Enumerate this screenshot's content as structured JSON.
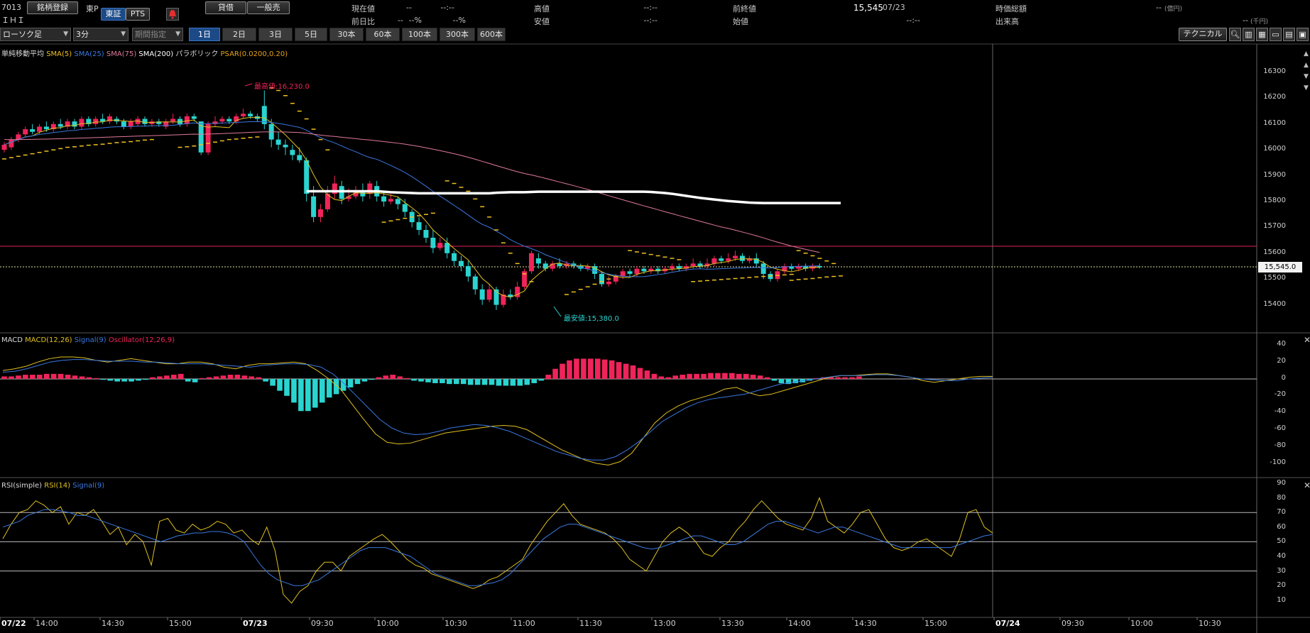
{
  "header": {
    "code": "7013",
    "name": "ＩＨＩ",
    "market_label": "東P",
    "register_button": "銘柄登録",
    "tse_button": "東証",
    "pts_button": "PTS",
    "loan_button": "貸借",
    "general_short_button": "一般売"
  },
  "quote": {
    "current_price_label": "現在値",
    "current_price_value": "--",
    "current_time": "--:--",
    "change_label": "前日比",
    "change_value": "--",
    "change_pct": "--%",
    "change_pct2": "--%",
    "high_label": "高値",
    "high_value": "--",
    "high_time": "--:--",
    "low_label": "安値",
    "low_value": "--",
    "low_time": "--:--",
    "prev_close_label": "前終値",
    "prev_close_value": "15,545",
    "prev_close_date": "07/23",
    "open_label": "始値",
    "open_value": "--",
    "open_time": "--:--",
    "market_cap_label": "時価総額",
    "market_cap_value": "--",
    "market_cap_unit": "(億円)",
    "volume_label": "出来高",
    "volume_value": "--",
    "volume_unit": "(千円)"
  },
  "toolbar": {
    "chart_type": "ローソク足",
    "interval": "3分",
    "range_select": "期間指定",
    "periods": [
      "1日",
      "2日",
      "3日",
      "5日",
      "30本",
      "60本",
      "100本",
      "300本",
      "600本"
    ],
    "active_period": 0,
    "technical_button": "テクニカル",
    "icons": [
      "zoom-icon",
      "bar-chart-icon",
      "table-icon",
      "folder-icon",
      "settings-icon"
    ]
  },
  "price_panel": {
    "legend": [
      "単純移動平均",
      "SMA(5)",
      "SMA(25)",
      "SMA(75)",
      "SMA(200)",
      "パラボリック",
      "PSAR(0.0200,0.20)"
    ],
    "legend_colors": [
      "#d8d8d8",
      "#f0c020",
      "#3a78e0",
      "#e0709a",
      "#ffffff",
      "#d8d8d8",
      "#e6a21a"
    ],
    "y_ticks": [
      "16300",
      "16200",
      "16100",
      "16000",
      "15900",
      "15800",
      "15700",
      "15600",
      "15500",
      "15400"
    ],
    "high_annotation": "最高値:16,230.0",
    "low_annotation": "最安値:15,380.0",
    "last_price_tag": "15,545.0",
    "colors": {
      "up": "#f0245a",
      "down": "#2ad4d0",
      "sma5": "#e0c020",
      "sma25": "#3a78e0",
      "sma75": "#e07a9a",
      "sma200": "#ffffff",
      "psar": "#f0c020"
    }
  },
  "macd_panel": {
    "legend": [
      "MACD",
      "MACD(12,26)",
      "Signal(9)",
      "Oscillator(12,26,9)"
    ],
    "legend_colors": [
      "#d8d8d8",
      "#e0c020",
      "#3a78e0",
      "#f0245a"
    ],
    "y_ticks": [
      "40",
      "20",
      "0",
      "-20",
      "-40",
      "-60",
      "-80",
      "-100"
    ]
  },
  "rsi_panel": {
    "legend": [
      "RSI(simple)",
      "RSI(14)",
      "Signal(9)"
    ],
    "legend_colors": [
      "#d8d8d8",
      "#e0c020",
      "#3a78e0"
    ],
    "y_ticks": [
      "90",
      "80",
      "70",
      "60",
      "50",
      "40",
      "30",
      "20",
      "10"
    ]
  },
  "x_axis": {
    "labels": [
      "07/22",
      "14:00",
      "14:30",
      "15:00",
      "07/23",
      "09:30",
      "10:00",
      "10:30",
      "11:00",
      "11:30",
      "13:00",
      "13:30",
      "14:00",
      "14:30",
      "15:00",
      "07/24",
      "09:30",
      "10:00",
      "10:30"
    ],
    "bold_labels": [
      "07/22",
      "07/23",
      "07/24"
    ]
  }
}
